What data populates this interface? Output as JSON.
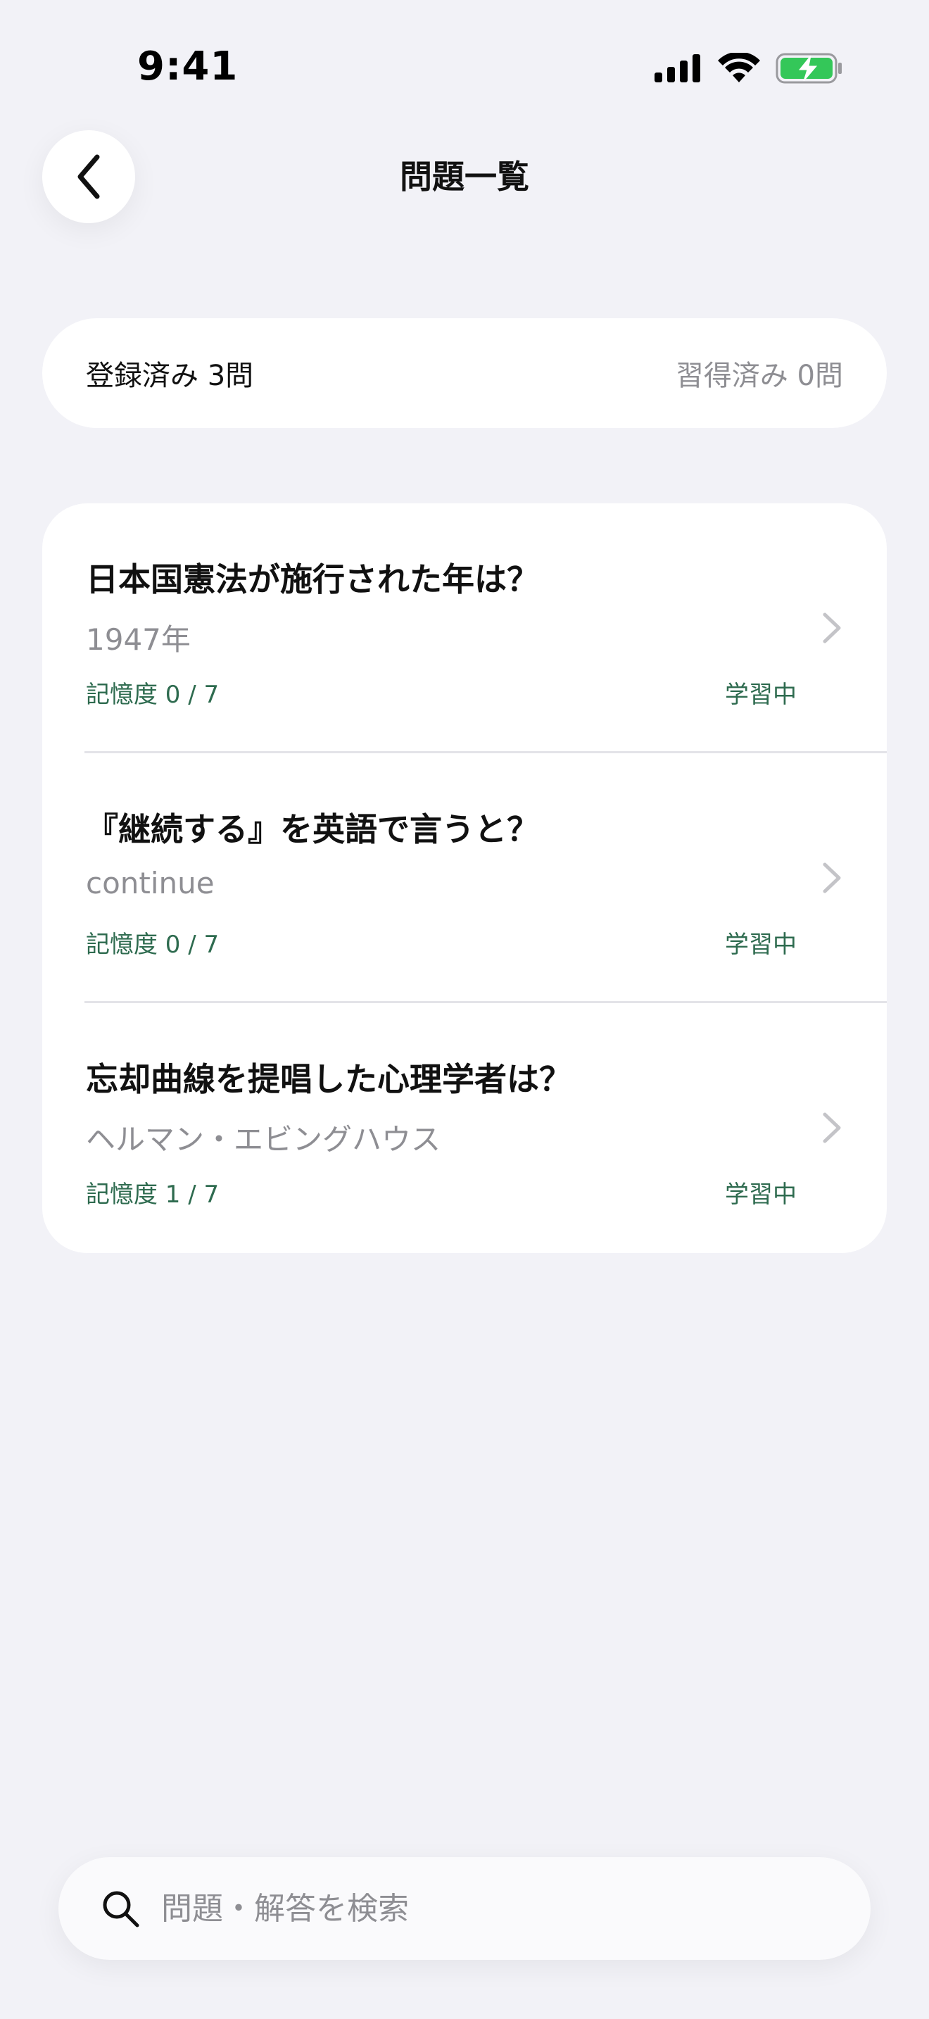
{
  "status_bar": {
    "time": "9:41",
    "signal_icon": "cellular-signal-icon",
    "wifi_icon": "wifi-icon",
    "battery_icon": "battery-charging-icon",
    "battery_color": "#34C759"
  },
  "nav": {
    "back_icon": "chevron-left-icon",
    "title": "問題一覧"
  },
  "summary": {
    "registered": "登録済み 3問",
    "mastered": "習得済み 0問"
  },
  "questions": [
    {
      "question": "日本国憲法が施行された年は？",
      "answer": "1947年",
      "memory": "記憶度 0 / 7",
      "status": "学習中"
    },
    {
      "question": "『継続する』を英語で言うと？",
      "answer": "continue",
      "memory": "記憶度 0 / 7",
      "status": "学習中"
    },
    {
      "question": "忘却曲線を提唱した心理学者は？",
      "answer": "ヘルマン・エビングハウス",
      "memory": "記憶度 1 / 7",
      "status": "学習中"
    }
  ],
  "search": {
    "icon": "search-icon",
    "placeholder": "問題・解答を検索",
    "value": ""
  },
  "colors": {
    "background": "#F2F2F7",
    "card": "#FFFFFF",
    "accent_green": "#2E6B4F",
    "secondary_text": "#8E8E93"
  }
}
